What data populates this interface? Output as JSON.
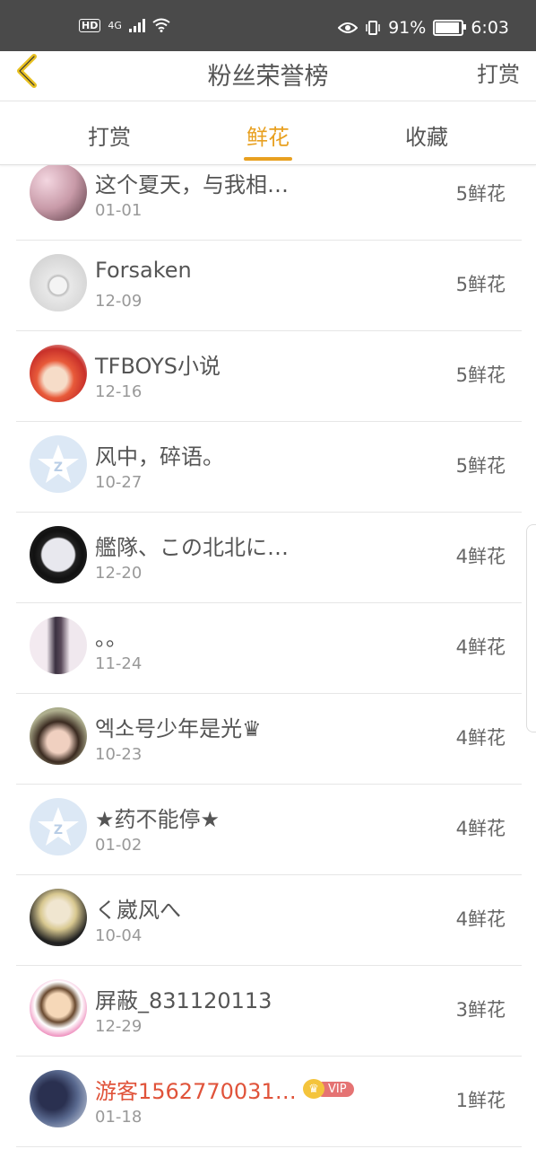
{
  "status_bar": {
    "hd": "HD",
    "net": "4G",
    "battery": "91%",
    "time": "6:03"
  },
  "header": {
    "title": "粉丝荣誉榜",
    "right_action": "打赏"
  },
  "tabs": [
    {
      "label": "打赏",
      "active": false
    },
    {
      "label": "鲜花",
      "active": true
    },
    {
      "label": "收藏",
      "active": false
    }
  ],
  "colors": {
    "accent": "#e8a020",
    "vip_name": "#e0533a",
    "status_bar": "#4a4a4a"
  },
  "rows": [
    {
      "name": "这个夏天，与我相…",
      "date": "01-01",
      "count": "5鲜花",
      "avatar": "blossom-photo"
    },
    {
      "name": "Forsaken",
      "date": "12-09",
      "count": "5鲜花",
      "avatar": "ring-photo"
    },
    {
      "name": "TFBOYS小说",
      "date": "12-16",
      "count": "5鲜花",
      "avatar": "anime-red-hair"
    },
    {
      "name": "风中，碎语。",
      "date": "10-27",
      "count": "5鲜花",
      "avatar": "default-star-avatar"
    },
    {
      "name": "艦隊、この北北に…",
      "date": "12-20",
      "count": "4鲜花",
      "avatar": "anime-circle"
    },
    {
      "name": "。。",
      "date": "11-24",
      "count": "4鲜花",
      "avatar": "girl-braid"
    },
    {
      "name": "엑소号少年是光♛",
      "date": "10-23",
      "count": "4鲜花",
      "avatar": "girl-cap-photo"
    },
    {
      "name": "★药不能停★",
      "date": "01-02",
      "count": "4鲜花",
      "avatar": "default-star-avatar"
    },
    {
      "name": "く崴风へ",
      "date": "10-04",
      "count": "4鲜花",
      "avatar": "anime-blond"
    },
    {
      "name": "屏蔽_831120113",
      "date": "12-29",
      "count": "3鲜花",
      "avatar": "cartoon-kid"
    },
    {
      "name": "游客1562770031…",
      "date": "01-18",
      "count": "1鲜花",
      "avatar": "couple-photo",
      "vip": true,
      "vip_label": "VIP"
    }
  ]
}
